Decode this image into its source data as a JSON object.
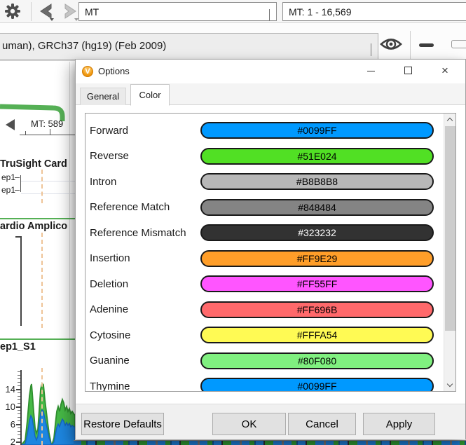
{
  "toolbar": {
    "locus_value": "MT",
    "range_value": "MT: 1 - 16,569"
  },
  "genome_bar": {
    "value": "uman), GRCh37 (hg19) (Feb 2009)"
  },
  "viewer": {
    "position": "MT: 589",
    "panel1_title": "TruSight Card",
    "row_labels": [
      "ep1",
      "ep1"
    ],
    "panel2_title": "ardio Amplico",
    "panel3_title": "ep1_S1",
    "axis": [
      "14",
      "10",
      "6",
      "2"
    ]
  },
  "dialog": {
    "title": "Options",
    "close_glyph": "×",
    "tabs": [
      "General",
      "Color"
    ],
    "color_rows": [
      {
        "label": "Forward",
        "value": "#0099FF",
        "text_color": "#000000"
      },
      {
        "label": "Reverse",
        "value": "#51E024",
        "text_color": "#000000"
      },
      {
        "label": "Intron",
        "value": "#B8B8B8",
        "text_color": "#000000"
      },
      {
        "label": "Reference Match",
        "value": "#848484",
        "text_color": "#000000"
      },
      {
        "label": "Reference Mismatch",
        "value": "#323232",
        "text_color": "#FFFFFF"
      },
      {
        "label": "Insertion",
        "value": "#FF9E29",
        "text_color": "#000000"
      },
      {
        "label": "Deletion",
        "value": "#FF55FF",
        "text_color": "#000000"
      },
      {
        "label": "Adenine",
        "value": "#FF696B",
        "text_color": "#000000"
      },
      {
        "label": "Cytosine",
        "value": "#FFFA54",
        "text_color": "#000000"
      },
      {
        "label": "Guanine",
        "value": "#80F080",
        "text_color": "#000000"
      },
      {
        "label": "Thymine",
        "value": "#0099FF",
        "text_color": "#000000"
      }
    ],
    "footer": {
      "restore_label": "Restore Defaults",
      "ok_label": "OK",
      "cancel_label": "Cancel",
      "apply_label": "Apply"
    }
  }
}
